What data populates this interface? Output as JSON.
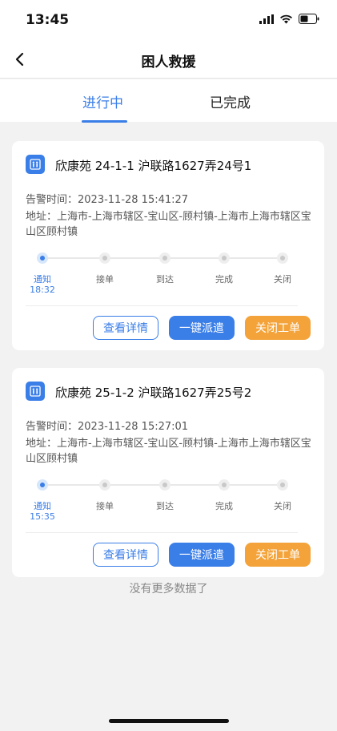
{
  "status": {
    "time": "13:45"
  },
  "nav": {
    "title": "困人救援"
  },
  "tabs": [
    {
      "label": "进行中",
      "active": true
    },
    {
      "label": "已完成",
      "active": false
    }
  ],
  "steps": [
    "通知",
    "接单",
    "到达",
    "完成",
    "关闭"
  ],
  "cards": [
    {
      "title": "欣康苑 24-1-1 沪联路1627弄24号1",
      "alarm_time": "告警时间：2023-11-28 15:41:27",
      "address": "地址：上海市-上海市辖区-宝山区-顾村镇-上海市上海市辖区宝山区顾村镇",
      "current_step_time": "18:32"
    },
    {
      "title": "欣康苑 25-1-2 沪联路1627弄25号2",
      "alarm_time": "告警时间：2023-11-28 15:27:01",
      "address": "地址：上海市-上海市辖区-宝山区-顾村镇-上海市上海市辖区宝山区顾村镇",
      "current_step_time": "15:35"
    }
  ],
  "buttons": {
    "detail": "查看详情",
    "dispatch": "一键派遣",
    "close": "关闭工单"
  },
  "footer": {
    "no_more": "没有更多数据了"
  },
  "colors": {
    "accent": "#3a7ee8",
    "warning": "#f3a33a"
  }
}
